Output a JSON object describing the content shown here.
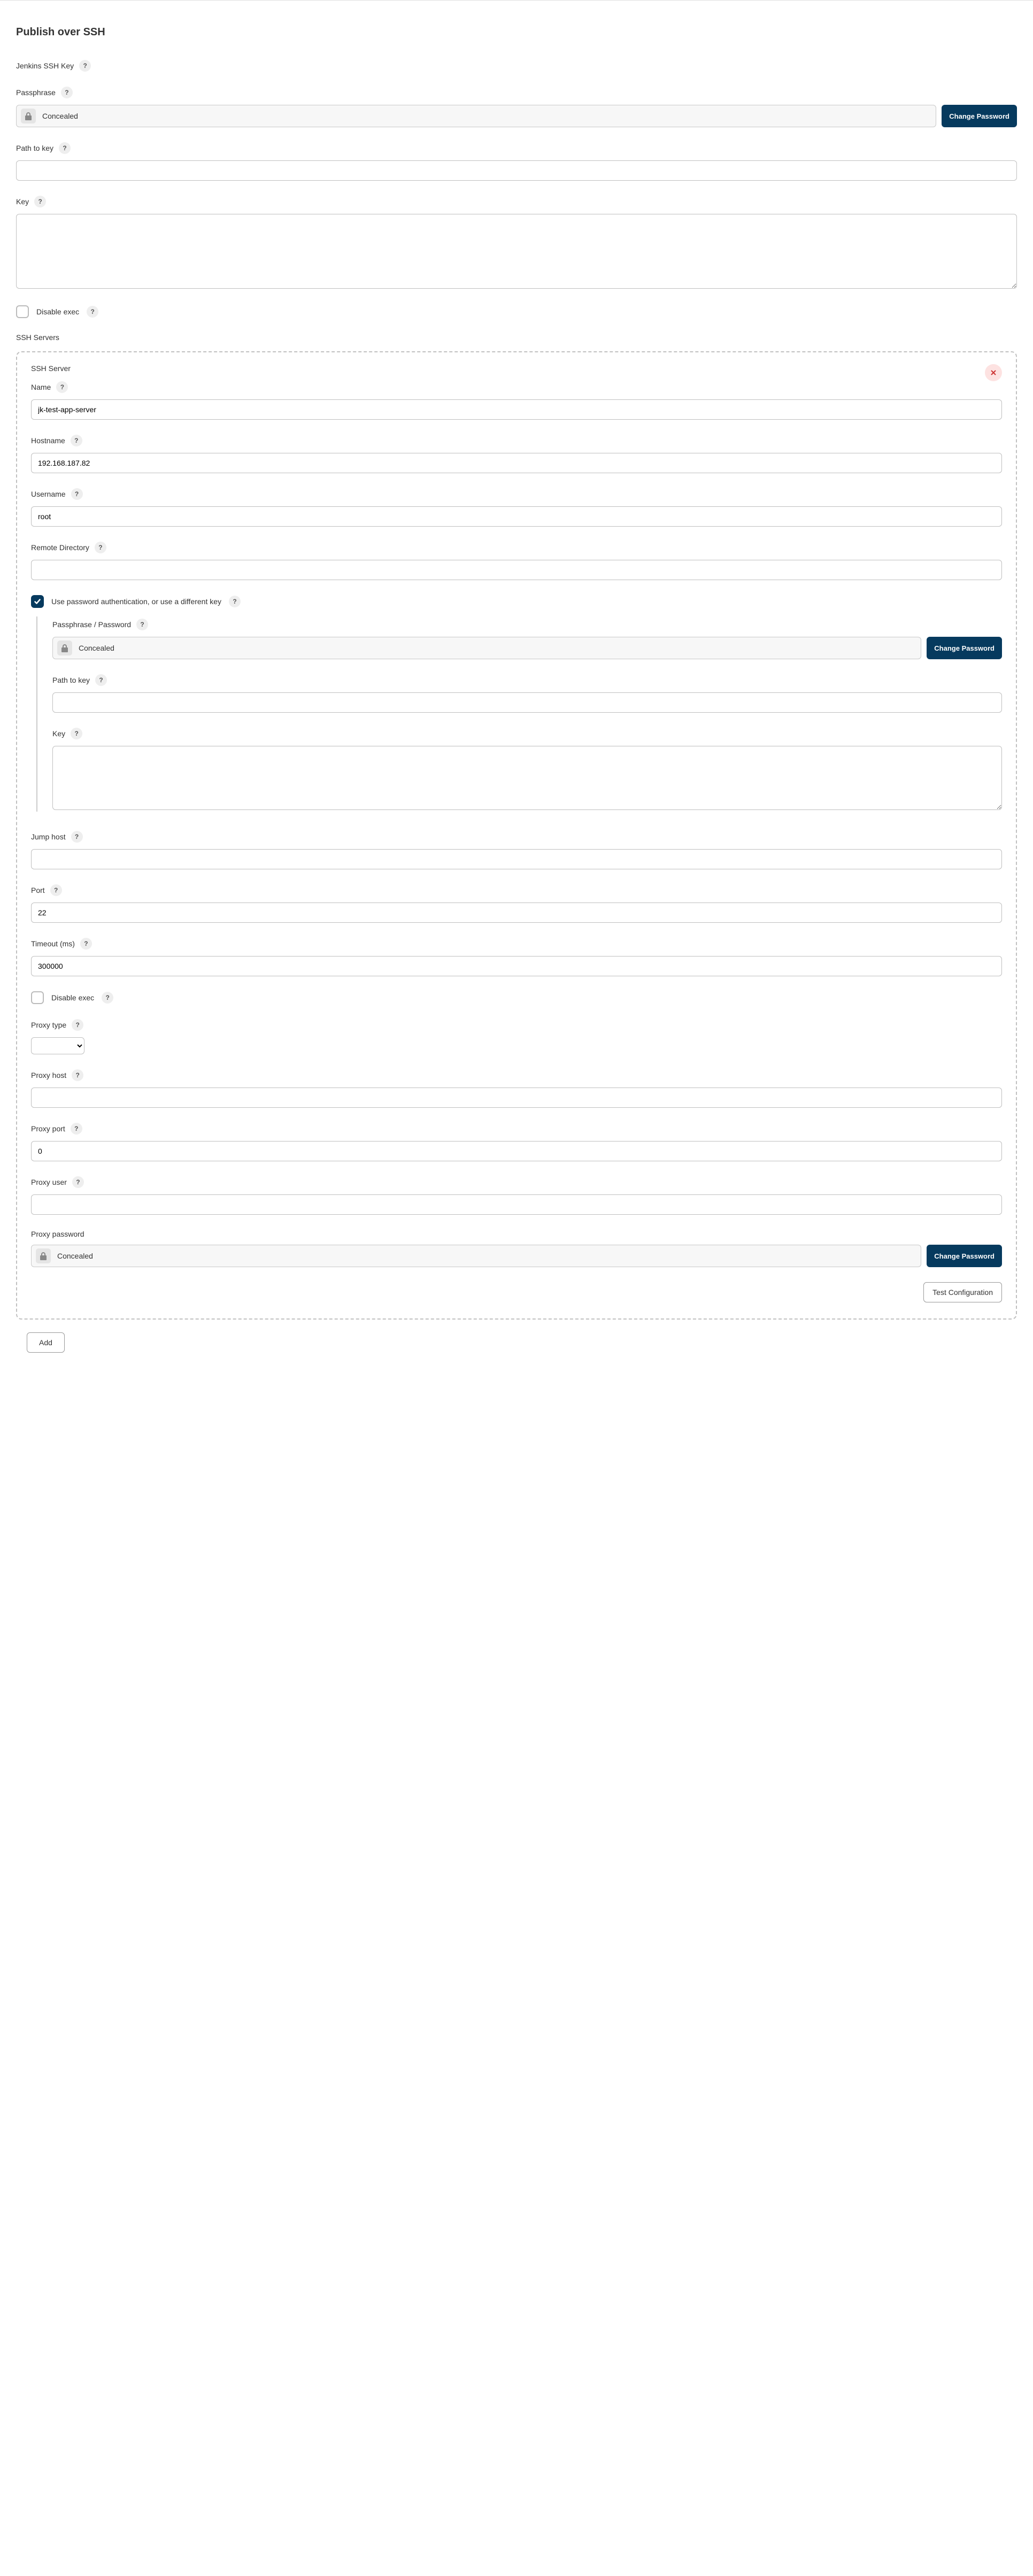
{
  "section_title": "Publish over SSH",
  "jenkins_ssh_key_label": "Jenkins SSH Key",
  "passphrase": {
    "label": "Passphrase",
    "concealed": "Concealed",
    "change_btn": "Change Password"
  },
  "path_to_key": {
    "label": "Path to key",
    "value": ""
  },
  "key": {
    "label": "Key",
    "value": ""
  },
  "disable_exec_label": "Disable exec",
  "ssh_servers_label": "SSH Servers",
  "server": {
    "title": "SSH Server",
    "name": {
      "label": "Name",
      "value": "jk-test-app-server"
    },
    "hostname": {
      "label": "Hostname",
      "value": "192.168.187.82"
    },
    "username": {
      "label": "Username",
      "value": "root"
    },
    "remote_dir": {
      "label": "Remote Directory",
      "value": ""
    },
    "use_password_label": "Use password authentication, or use a different key",
    "nested": {
      "passphrase": {
        "label": "Passphrase / Password",
        "concealed": "Concealed",
        "change_btn": "Change Password"
      },
      "path_to_key": {
        "label": "Path to key",
        "value": ""
      },
      "key": {
        "label": "Key",
        "value": ""
      }
    },
    "jump_host": {
      "label": "Jump host",
      "value": ""
    },
    "port": {
      "label": "Port",
      "value": "22"
    },
    "timeout": {
      "label": "Timeout (ms)",
      "value": "300000"
    },
    "disable_exec_label": "Disable exec",
    "proxy_type": {
      "label": "Proxy type",
      "value": ""
    },
    "proxy_host": {
      "label": "Proxy host",
      "value": ""
    },
    "proxy_port": {
      "label": "Proxy port",
      "value": "0"
    },
    "proxy_user": {
      "label": "Proxy user",
      "value": ""
    },
    "proxy_password": {
      "label": "Proxy password",
      "concealed": "Concealed",
      "change_btn": "Change Password"
    },
    "test_btn": "Test Configuration"
  },
  "add_btn": "Add"
}
